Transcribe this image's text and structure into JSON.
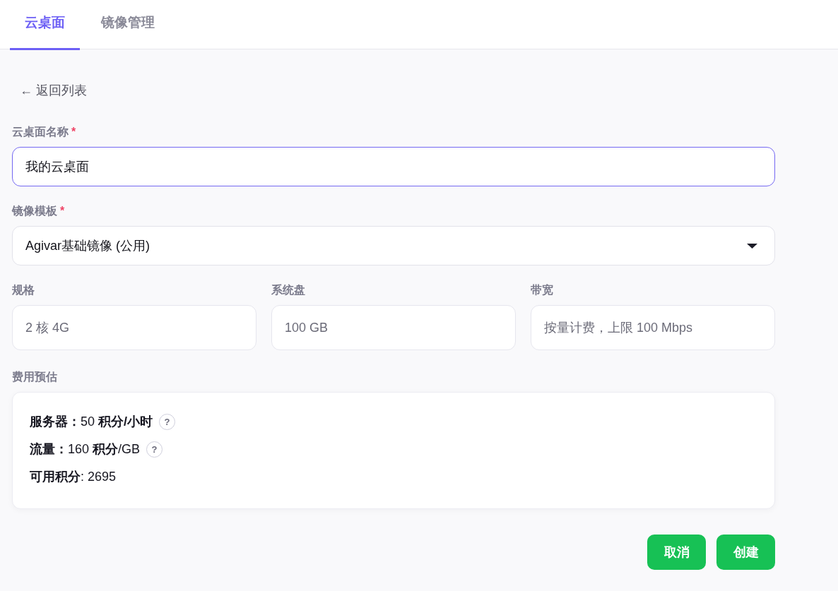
{
  "tabs": [
    {
      "label": "云桌面",
      "selected": true
    },
    {
      "label": "镜像管理",
      "selected": false
    }
  ],
  "back_link": {
    "label": "← 返回列表"
  },
  "form": {
    "name_field": {
      "label": "云桌面名称",
      "required_mark": "*",
      "value": "我的云桌面",
      "focused": true
    },
    "template_select": {
      "label": "镜像模板",
      "required_mark": "*",
      "value": "Agivar基础镜像 (公用)",
      "focused": false
    },
    "spec_fields": [
      {
        "label": "规格",
        "value": "2 核 4G"
      },
      {
        "label": "系统盘",
        "value": "100 GB"
      },
      {
        "label": "带宽",
        "value": "按量计费，上限 100 Mbps"
      }
    ],
    "cost_estimate": {
      "label": "费用预估",
      "lines": [
        {
          "text": "**服务器：**50 **积分/小时**",
          "help": "?"
        },
        {
          "text": "**流量：**160 **积分**/GB",
          "help": "?"
        },
        {
          "text": "**可用积分**: 2695"
        }
      ]
    }
  },
  "buttons": [
    {
      "label": "取消"
    },
    {
      "label": "创建"
    }
  ]
}
